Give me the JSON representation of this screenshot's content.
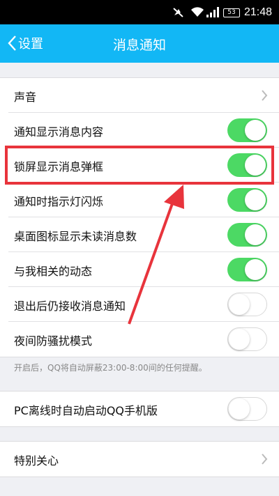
{
  "status_bar": {
    "time": "21:48",
    "battery": "53"
  },
  "header": {
    "back_label": "设置",
    "title": "消息通知"
  },
  "settings": [
    {
      "label": "声音",
      "control": "chevron"
    },
    {
      "label": "通知显示消息内容",
      "control": "toggle",
      "on": true
    },
    {
      "label": "锁屏显示消息弹框",
      "control": "toggle",
      "on": true
    },
    {
      "label": "通知时指示灯闪烁",
      "control": "toggle",
      "on": true
    },
    {
      "label": "桌面图标显示未读消息数",
      "control": "toggle",
      "on": true
    },
    {
      "label": "与我相关的动态",
      "control": "toggle",
      "on": true
    },
    {
      "label": "退出后仍接收消息通知",
      "control": "toggle",
      "on": false
    },
    {
      "label": "夜间防骚扰模式",
      "control": "toggle",
      "on": false
    }
  ],
  "night_mode_note": "开启后，QQ将自动屏蔽23:00-8:00间的任何提醒。",
  "pc_offline": {
    "label": "PC离线时自动启动QQ手机版",
    "on": false
  },
  "special_care": {
    "label": "特别关心"
  },
  "colors": {
    "header": "#12b7f5",
    "toggle_on": "#4cd964",
    "highlight": "#e8343c"
  }
}
